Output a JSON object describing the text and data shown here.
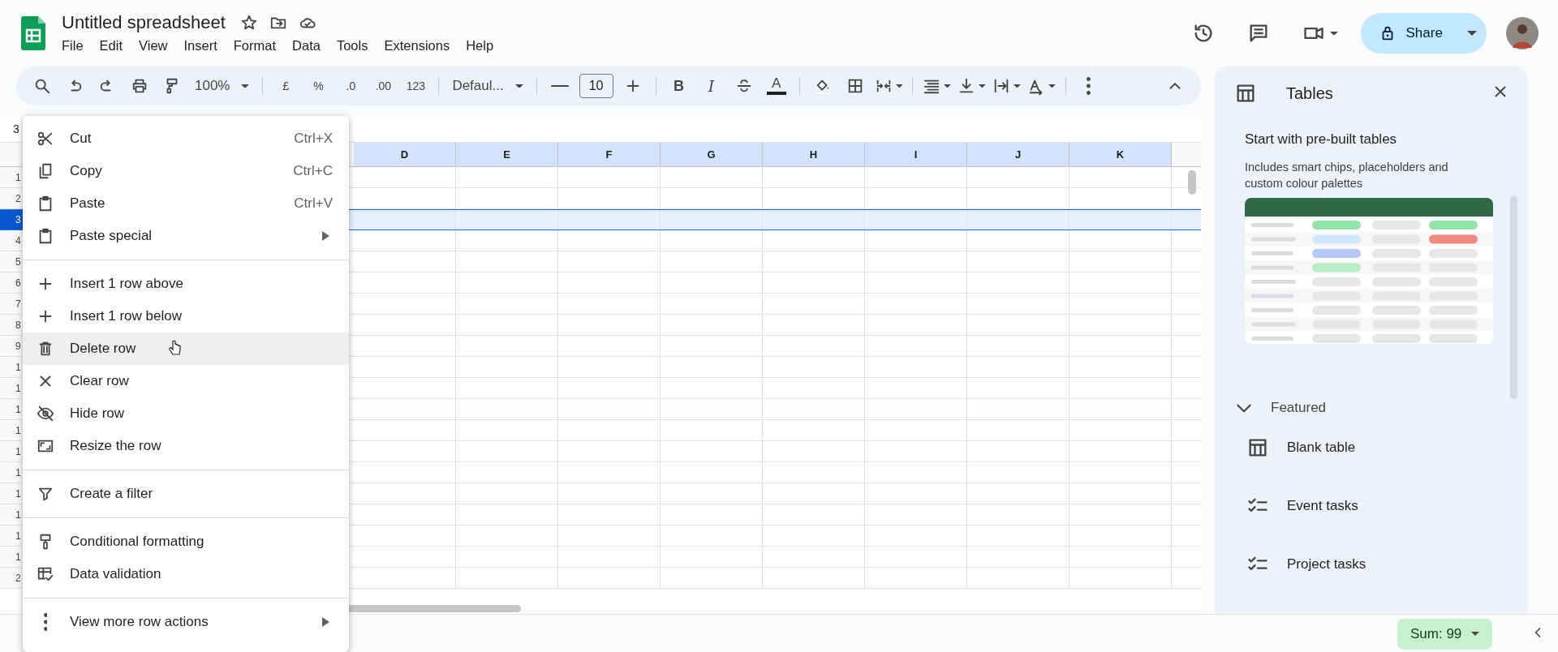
{
  "document": {
    "title": "Untitled spreadsheet"
  },
  "menu_bar": [
    "File",
    "Edit",
    "View",
    "Insert",
    "Format",
    "Data",
    "Tools",
    "Extensions",
    "Help"
  ],
  "share_button": {
    "label": "Share"
  },
  "toolbar": {
    "zoom": "100%",
    "currency": "£",
    "percent": "%",
    "decrease_decimals": ".0",
    "increase_decimals": ".00",
    "number_format": "123",
    "font": "Defaul...",
    "font_size": "10",
    "bold": "B",
    "italic": "I",
    "text_color": "A"
  },
  "name_box": "3",
  "grid": {
    "columns": [
      "D",
      "E",
      "F",
      "G",
      "H",
      "I",
      "J",
      "K"
    ],
    "rows": [
      {
        "number": "1",
        "selected": false
      },
      {
        "number": "2",
        "selected": false
      },
      {
        "number": "3",
        "selected": true
      },
      {
        "number": "4",
        "selected": false
      },
      {
        "number": "5",
        "selected": false
      },
      {
        "number": "6",
        "selected": false
      },
      {
        "number": "7",
        "selected": false
      },
      {
        "number": "8",
        "selected": false
      },
      {
        "number": "9",
        "selected": false
      },
      {
        "number": "1",
        "selected": false
      },
      {
        "number": "1",
        "selected": false
      },
      {
        "number": "1",
        "selected": false
      },
      {
        "number": "1",
        "selected": false
      },
      {
        "number": "1",
        "selected": false
      },
      {
        "number": "1",
        "selected": false
      },
      {
        "number": "1",
        "selected": false
      },
      {
        "number": "1",
        "selected": false
      },
      {
        "number": "1",
        "selected": false
      },
      {
        "number": "1",
        "selected": false
      },
      {
        "number": "2",
        "selected": false
      }
    ]
  },
  "context_menu": {
    "sections": [
      {
        "items": [
          {
            "label": "Cut",
            "shortcut": "Ctrl+X",
            "submenu": false,
            "hovered": false
          },
          {
            "label": "Copy",
            "shortcut": "Ctrl+C",
            "submenu": false,
            "hovered": false
          },
          {
            "label": "Paste",
            "shortcut": "Ctrl+V",
            "submenu": false,
            "hovered": false
          },
          {
            "label": "Paste special",
            "submenu": true,
            "hovered": false
          }
        ]
      },
      {
        "items": [
          {
            "label": "Insert 1 row above",
            "submenu": false,
            "hovered": false
          },
          {
            "label": "Insert 1 row below",
            "submenu": false,
            "hovered": false
          },
          {
            "label": "Delete row",
            "submenu": false,
            "hovered": true
          },
          {
            "label": "Clear row",
            "submenu": false,
            "hovered": false
          },
          {
            "label": "Hide row",
            "submenu": false,
            "hovered": false
          },
          {
            "label": "Resize the row",
            "submenu": false,
            "hovered": false
          }
        ]
      },
      {
        "items": [
          {
            "label": "Create a filter",
            "submenu": false,
            "hovered": false
          }
        ]
      },
      {
        "items": [
          {
            "label": "Conditional formatting",
            "submenu": false,
            "hovered": false
          },
          {
            "label": "Data validation",
            "submenu": false,
            "hovered": false
          }
        ]
      },
      {
        "items": [
          {
            "label": "View more row actions",
            "submenu": true,
            "hovered": false
          }
        ]
      }
    ]
  },
  "side_panel": {
    "title": "Tables",
    "heading": "Start with pre-built tables",
    "description": "Includes smart chips, placeholders and custom colour palettes",
    "featured": {
      "label": "Featured",
      "expanded": true,
      "items": [
        "Blank table",
        "Event tasks",
        "Project tasks"
      ]
    }
  },
  "status_bar": {
    "sum": "Sum: 99"
  }
}
